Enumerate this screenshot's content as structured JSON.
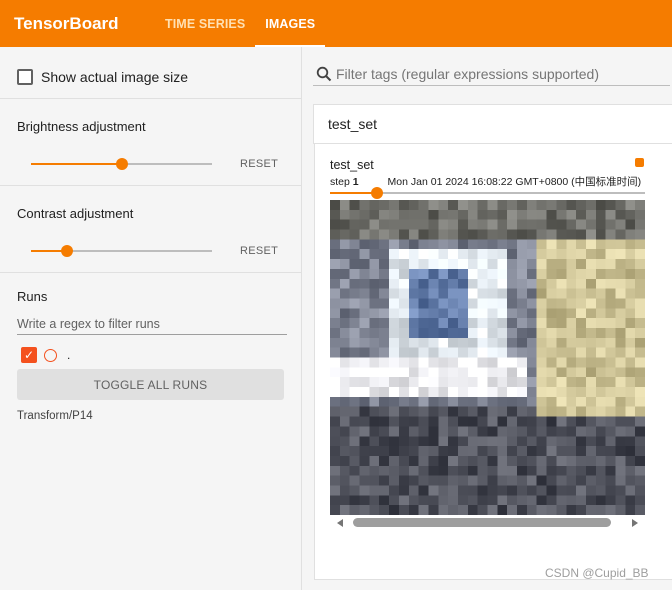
{
  "header": {
    "brand": "TensorBoard",
    "tabs": [
      {
        "label": "TIME SERIES",
        "active": false
      },
      {
        "label": "IMAGES",
        "active": true
      }
    ],
    "color": "#f57c00"
  },
  "sidebar": {
    "actual_size_label": "Show actual image size",
    "brightness": {
      "title": "Brightness adjustment",
      "value": 0.5,
      "reset_label": "RESET"
    },
    "contrast": {
      "title": "Contrast adjustment",
      "value": 0.2,
      "reset_label": "RESET"
    },
    "runs": {
      "title": "Runs",
      "filter_placeholder": "Write a regex to filter runs",
      "items": [
        {
          "name": ".",
          "checked": true,
          "color": "#f4511e"
        }
      ],
      "toggle_label": "TOGGLE ALL RUNS",
      "caption": "Transform/P14"
    }
  },
  "main": {
    "filter_placeholder": "Filter tags (regular expressions supported)",
    "group_title": "test_set",
    "card": {
      "title": "test_set",
      "step_label": "step",
      "step_value": "1",
      "timestamp": "Mon Jan 01 2024 16:08:22 GMT+0800 (中国标准时间)",
      "step_position": 0.15
    }
  },
  "watermark": "CSDN @Cupid_BB"
}
